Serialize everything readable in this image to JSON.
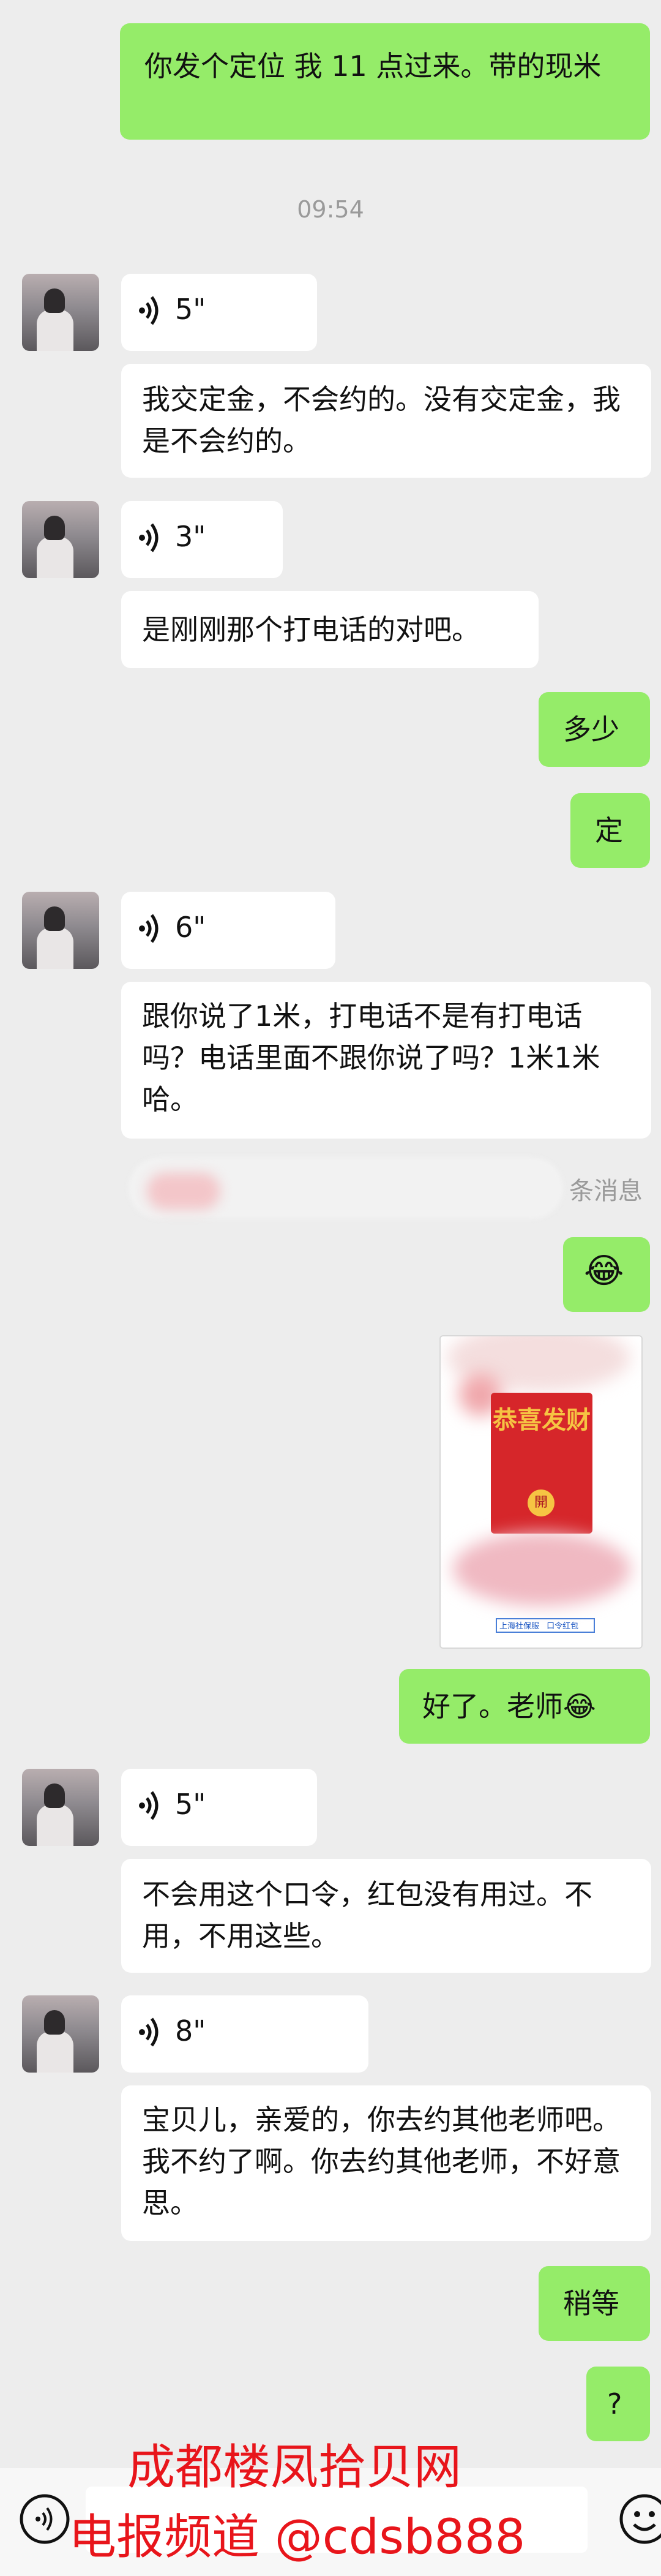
{
  "messages": {
    "m1": "你发个定位 我 11 点过来。带的现米",
    "time1": "09:54",
    "v1": "5\"",
    "t1": "我交定金，不会约的。没有交定金，我是不会约的。",
    "v2": "3\"",
    "t2": "是刚刚那个打电话的对吧。",
    "o1": "多少",
    "o2": "定",
    "v3": "6\"",
    "t3": "跟你说了1米，打电话不是有打电话吗？电话里面不跟你说了吗？1米1米哈。",
    "sys": "条消息",
    "o3_emoji": "😂",
    "card_title": "恭喜发财",
    "card_seal": "開",
    "card_footer_a": "上海社保服",
    "card_footer_b": "口令红包",
    "o4": "好了。老师😂",
    "v4": "5\"",
    "t4": "不会用这个口令，红包没有用过。不用，不用这些。",
    "v5": "8\"",
    "t5": "宝贝儿，亲爱的，你去约其他老师吧。我不约了啊。你去约其他老师，不好意思。",
    "o5": "稍等",
    "o6": "?"
  },
  "watermark": {
    "line1": "成都楼凤拾贝网",
    "line2": "电报频道 @cdsb888"
  },
  "icons": [
    "voice-icon",
    "emoji-icon",
    "avatar"
  ],
  "colors": {
    "outgoing": "#95ec69",
    "incoming": "#ffffff",
    "bg": "#ededed",
    "watermark": "#e8151b"
  }
}
